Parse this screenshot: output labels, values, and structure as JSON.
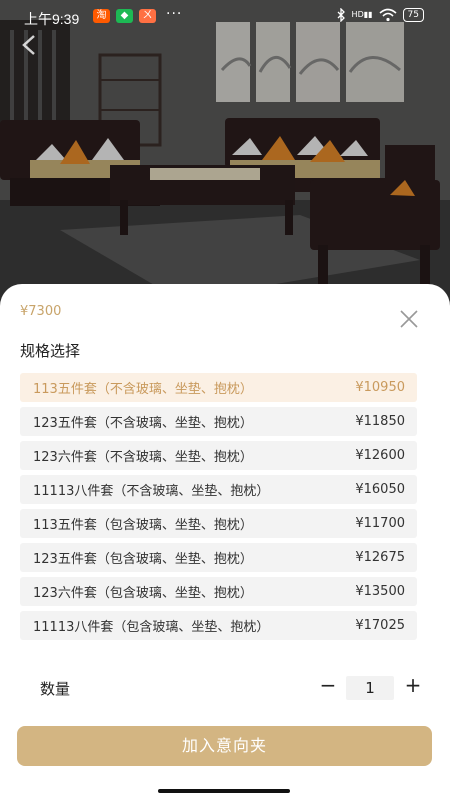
{
  "status_bar": {
    "time": "上午9:39",
    "app1": "淘",
    "app2": "◆",
    "app3": "ㄨ",
    "more": "···",
    "signal": "HD",
    "battery": "75"
  },
  "sheet": {
    "base_price": "¥7300",
    "section_title": "规格选择",
    "options": [
      {
        "name": "113五件套（不含玻璃、坐垫、抱枕）",
        "price": "¥10950",
        "selected": true
      },
      {
        "name": "123五件套（不含玻璃、坐垫、抱枕）",
        "price": "¥11850",
        "selected": false
      },
      {
        "name": "123六件套（不含玻璃、坐垫、抱枕）",
        "price": "¥12600",
        "selected": false
      },
      {
        "name": "11113八件套（不含玻璃、坐垫、抱枕）",
        "price": "¥16050",
        "selected": false
      },
      {
        "name": "113五件套（包含玻璃、坐垫、抱枕）",
        "price": "¥11700",
        "selected": false
      },
      {
        "name": "123五件套（包含玻璃、坐垫、抱枕）",
        "price": "¥12675",
        "selected": false
      },
      {
        "name": "123六件套（包含玻璃、坐垫、抱枕）",
        "price": "¥13500",
        "selected": false
      },
      {
        "name": "11113八件套（包含玻璃、坐垫、抱枕）",
        "price": "¥17025",
        "selected": false
      }
    ],
    "quantity_label": "数量",
    "quantity_minus": "−",
    "quantity_value": "1",
    "quantity_plus": "+",
    "add_button": "加入意向夹"
  },
  "colors": {
    "accent": "#d3b582",
    "selected_bg": "#fbf0e4",
    "selected_text": "#c99a5d",
    "price_text": "#c8a46a"
  },
  "icons": {
    "close": "close-icon",
    "back": "back-arrow-icon"
  }
}
